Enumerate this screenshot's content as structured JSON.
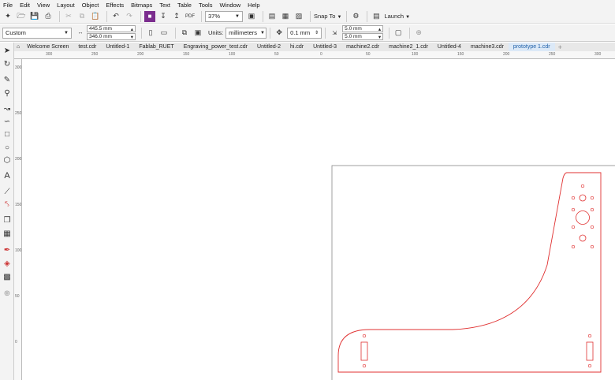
{
  "menu": [
    "File",
    "Edit",
    "View",
    "Layout",
    "Object",
    "Effects",
    "Bitmaps",
    "Text",
    "Table",
    "Tools",
    "Window",
    "Help"
  ],
  "toolbar1": {
    "zoom": "37%",
    "snap_label": "Snap To",
    "launch_label": "Launch"
  },
  "toolbar2": {
    "page_size": "Custom",
    "width": "445.5 mm",
    "height": "346.0 mm",
    "units_label": "Units:",
    "units_value": "millimeters",
    "nudge": "0.1 mm",
    "dup_x": "5.0 mm",
    "dup_y": "5.0 mm"
  },
  "tabs": [
    "Welcome Screen",
    "test.cdr",
    "Untitled-1",
    "Fablab_RUET",
    "Engraving_power_test.cdr",
    "Untitled-2",
    "hi.cdr",
    "Untitled-3",
    "machine2.cdr",
    "machine2_1.cdr",
    "Untitled-4",
    "machine3.cdr",
    "prototype 1.cdr"
  ],
  "active_tab": "prototype 1.cdr",
  "ruler_top": [
    "300",
    "250",
    "200",
    "150",
    "100",
    "50",
    "0",
    "50",
    "100",
    "150",
    "200",
    "250",
    "300"
  ],
  "ruler_left": [
    "300",
    "250",
    "200",
    "150",
    "100",
    "50",
    "0"
  ],
  "colors": {
    "outline": "#e03030",
    "active_tab": "#1d5fa8"
  }
}
